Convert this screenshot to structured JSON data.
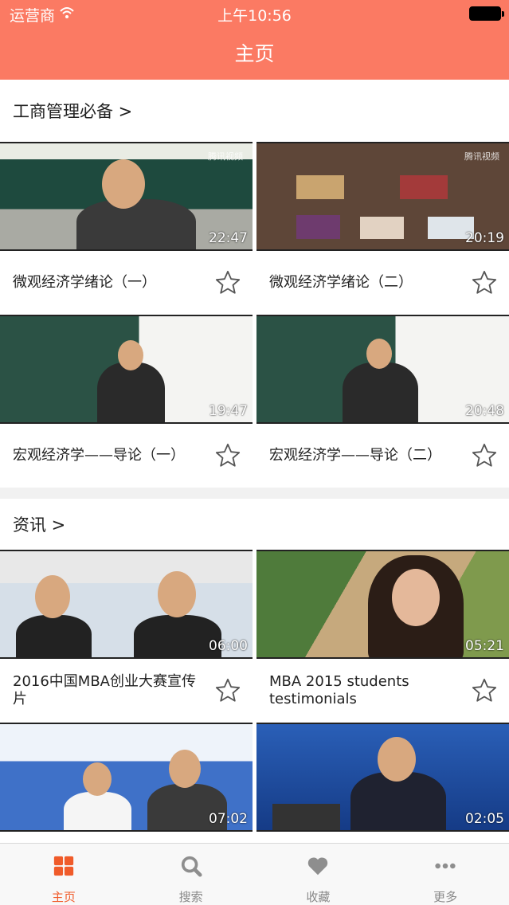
{
  "status": {
    "carrier": "运营商",
    "time": "上午10:56"
  },
  "nav": {
    "title": "主页"
  },
  "sections": [
    {
      "title": "工商管理必备 >",
      "items": [
        {
          "title": "微观经济学绪论（一）",
          "duration": "22:47",
          "watermark": "腾讯视频"
        },
        {
          "title": "微观经济学绪论（二）",
          "duration": "20:19",
          "watermark": "腾讯视频"
        },
        {
          "title": "宏观经济学——导论（一）",
          "duration": "19:47"
        },
        {
          "title": "宏观经济学——导论（二）",
          "duration": "20:48"
        }
      ]
    },
    {
      "title": "资讯 >",
      "items": [
        {
          "title": "2016中国MBA创业大赛宣传片",
          "duration": "06:00"
        },
        {
          "title": "MBA 2015 students testimonials",
          "duration": "05:21"
        },
        {
          "title": "",
          "duration": "07:02"
        },
        {
          "title": "",
          "duration": "02:05"
        }
      ]
    }
  ],
  "tabs": [
    {
      "label": "主页",
      "icon": "home-grid-icon",
      "active": true
    },
    {
      "label": "搜索",
      "icon": "search-icon",
      "active": false
    },
    {
      "label": "收藏",
      "icon": "heart-icon",
      "active": false
    },
    {
      "label": "更多",
      "icon": "more-dots-icon",
      "active": false
    }
  ],
  "colors": {
    "nav": "#fb7a63",
    "tab_active": "#f05b2a",
    "tab_inactive": "#8e8e8e"
  }
}
